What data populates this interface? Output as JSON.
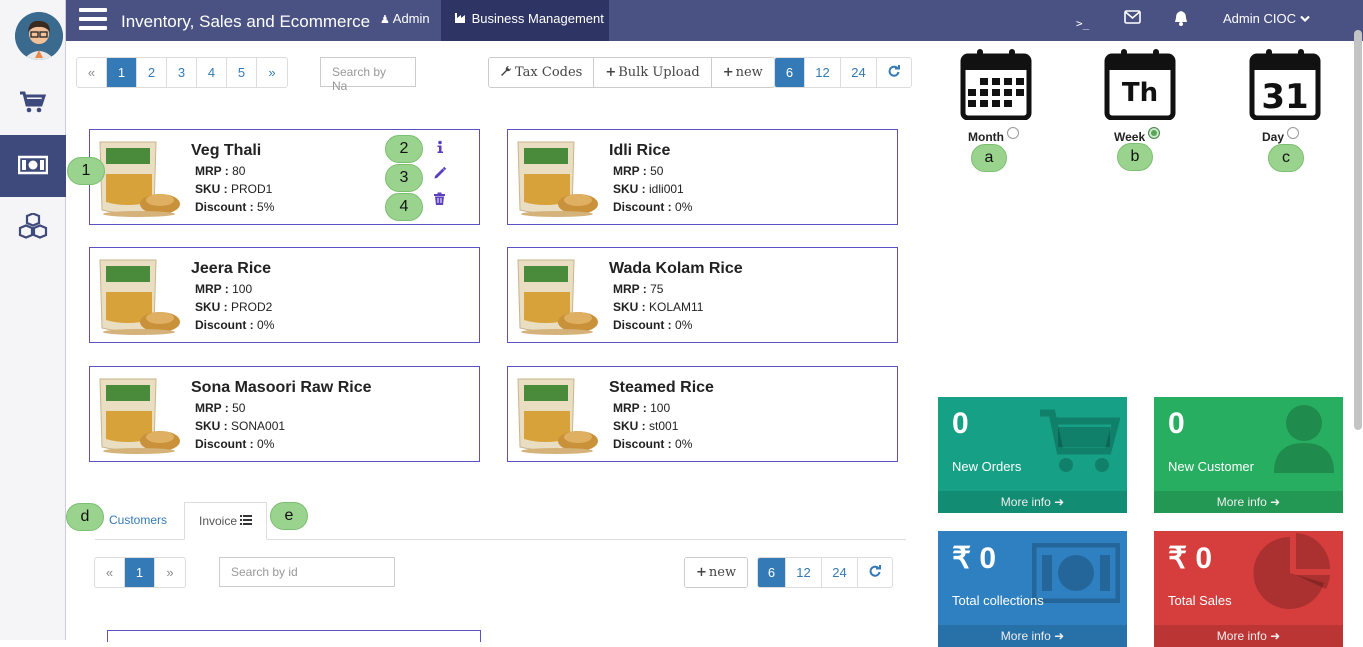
{
  "header": {
    "app_title": "Inventory, Sales and Ecommerce",
    "nav_admin": "Admin",
    "nav_business": "Business Management",
    "terminal_glyph": ">_",
    "user_menu": "Admin CIOC"
  },
  "sidebar": {
    "items": [
      {
        "icon": "cart-icon"
      },
      {
        "icon": "money-icon",
        "active": true
      },
      {
        "icon": "cubes-icon"
      }
    ]
  },
  "products_pager": {
    "prev": "«",
    "pages": [
      "1",
      "2",
      "3",
      "4",
      "5"
    ],
    "next": "»",
    "active": "1"
  },
  "product_search": {
    "placeholder": "Search by Na"
  },
  "toolbar": {
    "tax_codes": "Tax Codes",
    "bulk_upload": "Bulk Upload",
    "new": "new"
  },
  "page_size": {
    "options": [
      "6",
      "12",
      "24"
    ],
    "active": "6"
  },
  "product_fields": {
    "mrp": "MRP :",
    "sku": "SKU :",
    "discount": "Discount :"
  },
  "products": [
    {
      "name": "Veg Thali",
      "mrp": "80",
      "sku": "PROD1",
      "discount": "5%"
    },
    {
      "name": "Idli Rice",
      "mrp": "50",
      "sku": "idli001",
      "discount": "0%"
    },
    {
      "name": "Jeera Rice",
      "mrp": "100",
      "sku": "PROD2",
      "discount": "0%"
    },
    {
      "name": "Wada Kolam Rice",
      "mrp": "75",
      "sku": "KOLAM11",
      "discount": "0%"
    },
    {
      "name": "Sona Masoori Raw Rice",
      "mrp": "50",
      "sku": "SONA001",
      "discount": "0%"
    },
    {
      "name": "Steamed Rice",
      "mrp": "100",
      "sku": "st001",
      "discount": "0%"
    }
  ],
  "markers": {
    "m1": "1",
    "m2": "2",
    "m3": "3",
    "m4": "4",
    "ma": "a",
    "mb": "b",
    "mc": "c",
    "md": "d",
    "me": "e"
  },
  "calendar": {
    "month_label": "Month",
    "week_label": "Week",
    "day_label": "Day",
    "week_icon_text": "Th",
    "day_icon_text": "31",
    "selected": "Week"
  },
  "stats": [
    {
      "value": "0",
      "label": "New Orders",
      "more": "More info",
      "color": "#16a085"
    },
    {
      "value": "0",
      "label": "New Customer",
      "more": "More info",
      "color": "#27ae60"
    },
    {
      "value": "₹ 0",
      "label": "Total collections",
      "more": "More info",
      "color": "#2e80c0"
    },
    {
      "value": "₹ 0",
      "label": "Total Sales",
      "more": "More info",
      "color": "#d63d3d"
    }
  ],
  "tabs": {
    "customers": "Customers",
    "invoice": "Invoice"
  },
  "invoice_pager": {
    "prev": "«",
    "page": "1",
    "next": "»"
  },
  "invoice_search": {
    "placeholder": "Search by id"
  },
  "invoice_new": "new",
  "invoice_page_size": {
    "options": [
      "6",
      "12",
      "24"
    ],
    "active": "6"
  }
}
